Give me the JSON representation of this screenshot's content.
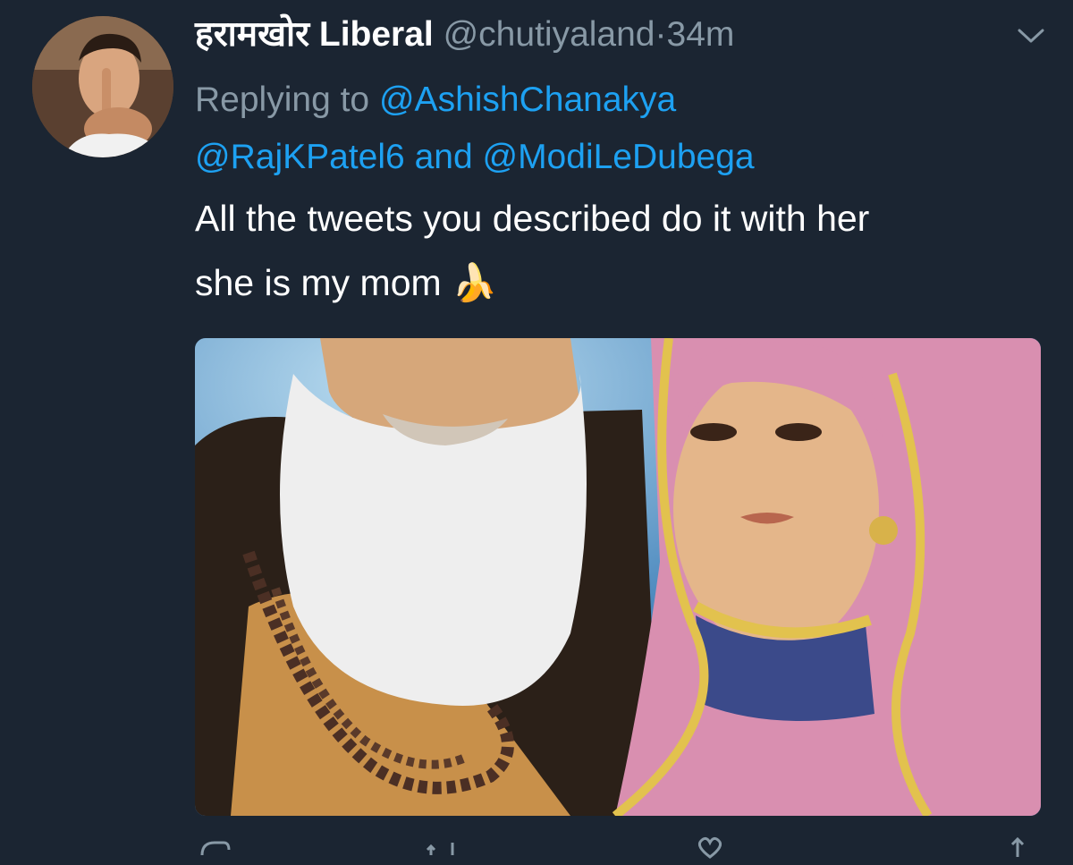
{
  "tweet": {
    "display_name": "हरामखोर Liberal",
    "handle": "@chutiyaland",
    "separator": "·",
    "time": "34m",
    "replying_prefix": "Replying to",
    "mentions": [
      "@AshishChanakya",
      "@RajKPatel6",
      "@ModiLeDubega"
    ],
    "mentions_joiner": "and",
    "text_line1": "All the tweets you described do it with her",
    "text_line2": "she is my mom",
    "emoji": "🍌"
  },
  "icons": {
    "menu": "chevron-down-icon",
    "reply": "reply-icon",
    "retweet": "retweet-icon",
    "like": "heart-icon",
    "share": "share-icon"
  },
  "colors": {
    "background": "#1b2532",
    "link": "#1da1f2",
    "muted": "#8899a6",
    "text": "#ffffff"
  }
}
